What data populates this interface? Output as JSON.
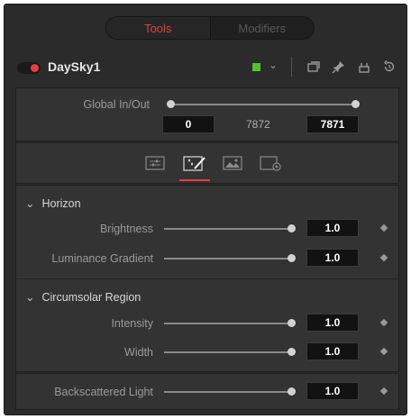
{
  "tabs": {
    "tools": "Tools",
    "modifiers": "Modifiers"
  },
  "tool": {
    "name": "DaySky1",
    "color": "#55c036"
  },
  "global": {
    "label": "Global In/Out",
    "in_value": "0",
    "mid_value": "7872",
    "out_value": "7871"
  },
  "horizon": {
    "title": "Horizon",
    "brightness": {
      "label": "Brightness",
      "value": "1.0"
    },
    "luminance_gradient": {
      "label": "Luminance Gradient",
      "value": "1.0"
    }
  },
  "circumsolar": {
    "title": "Circumsolar Region",
    "intensity": {
      "label": "Intensity",
      "value": "1.0"
    },
    "width": {
      "label": "Width",
      "value": "1.0"
    }
  },
  "backscattered": {
    "label": "Backscattered Light",
    "value": "1.0"
  },
  "colors": {
    "accent_red": "#e0413e",
    "panel_bg": "#2b2b2b"
  }
}
